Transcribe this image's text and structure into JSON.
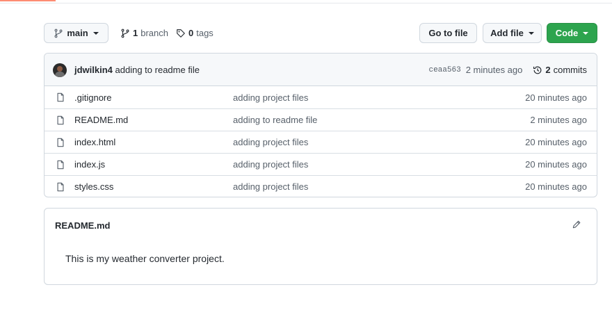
{
  "toolbar": {
    "branch_label": "main",
    "branch_count": "1",
    "branch_word": "branch",
    "tag_count": "0",
    "tag_word": "tags",
    "go_to_file": "Go to file",
    "add_file": "Add file",
    "code": "Code"
  },
  "commit": {
    "author": "jdwilkin4",
    "message": "adding to readme file",
    "sha": "ceaa563",
    "time": "2 minutes ago",
    "commit_count": "2",
    "commit_word": "commits"
  },
  "files": [
    {
      "name": ".gitignore",
      "message": "adding project files",
      "age": "20 minutes ago"
    },
    {
      "name": "README.md",
      "message": "adding to readme file",
      "age": "2 minutes ago"
    },
    {
      "name": "index.html",
      "message": "adding project files",
      "age": "20 minutes ago"
    },
    {
      "name": "index.js",
      "message": "adding project files",
      "age": "20 minutes ago"
    },
    {
      "name": "styles.css",
      "message": "adding project files",
      "age": "20 minutes ago"
    }
  ],
  "readme": {
    "title": "README.md",
    "body": "This is my weather converter project."
  },
  "icons": {
    "branch": "git-branch-icon",
    "tag": "tag-icon",
    "history": "history-icon",
    "file": "file-icon",
    "edit": "pencil-icon"
  },
  "colors": {
    "primary_button": "#2da44e",
    "accent": "#fd8c73"
  }
}
